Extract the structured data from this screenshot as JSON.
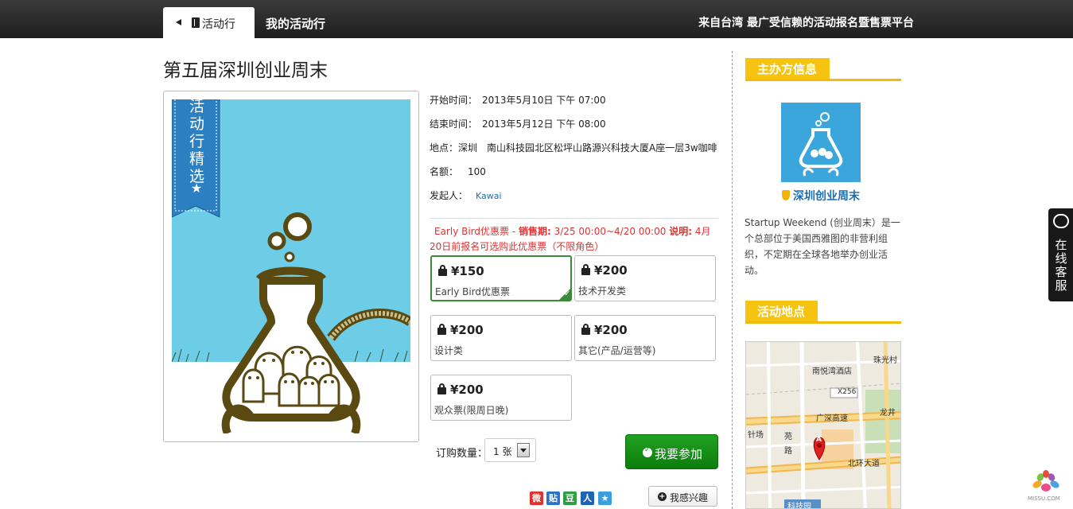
{
  "header": {
    "tabs": [
      {
        "label": "活动行",
        "active": true
      },
      {
        "label": "我的活动行",
        "active": false
      }
    ],
    "slogan": "来自台湾 最广受信赖的活动报名暨售票平台"
  },
  "event": {
    "title": "第五届深圳创业周末",
    "banner_text": "活动行精选",
    "start": {
      "label": "开始时间：",
      "value": "2013年5月10日 下午 07:00"
    },
    "end": {
      "label": "结束时间：",
      "value": "2013年5月12日 下午 08:00"
    },
    "location": {
      "label": "地点：",
      "value": "深圳　南山科技园北区松坪山路源兴科技大厦A座一层3w咖啡"
    },
    "quota": {
      "label": "名额：",
      "value": "100"
    },
    "organizer": {
      "label": "发起人：",
      "value": "Kawai"
    }
  },
  "ticket_note": {
    "name": "Early Bird优惠票 - ",
    "sale_label": "销售期:",
    "sale_period": " 3/25 00:00~4/20 00:00 ",
    "desc_label": "说明:",
    "desc": " 4月20日前报名可选购此优惠票（不限角色）"
  },
  "tickets": [
    {
      "price": "¥150",
      "name": "Early Bird优惠票",
      "selected": true
    },
    {
      "price": "¥200",
      "name": "技术开发类",
      "selected": false
    },
    {
      "price": "¥200",
      "name": "设计类",
      "selected": false
    },
    {
      "price": "¥200",
      "name": "其它(产品/运营等)",
      "selected": false
    },
    {
      "price": "¥200",
      "name": "观众票(限周日晚)",
      "selected": false
    }
  ],
  "order": {
    "qty_label": "订购数量：",
    "qty_value": "1 张",
    "join_label": "我要参加",
    "interest_label": "我感兴趣"
  },
  "share_icons": [
    {
      "icon": "weibo-icon",
      "glyph": "微",
      "color": "#e0322d"
    },
    {
      "icon": "tieba-icon",
      "glyph": "贴",
      "color": "#2a73c9"
    },
    {
      "icon": "douban-icon",
      "glyph": "豆",
      "color": "#2f9d43"
    },
    {
      "icon": "renren-icon",
      "glyph": "人",
      "color": "#1f63b8"
    },
    {
      "icon": "qzone-icon",
      "glyph": "★",
      "color": "#3a9fe0"
    }
  ],
  "sidebar": {
    "organizer_heading": "主办方信息",
    "org_name": "深圳创业周末",
    "org_desc": "Startup Weekend (创业周末）是一个总部位于美国西雅图的非营利组织，不定期在全球各地举办创业活动。",
    "location_heading": "活动地点",
    "map_labels": {
      "l1": "珠光村",
      "l2": "南悦湾酒店",
      "l3": "X256",
      "l4": "广深高速",
      "l5": "龙井",
      "l6": "针场",
      "l7": "苑",
      "l8": "路",
      "l9": "北环大道",
      "l10": "科技园",
      "marker": "A"
    }
  },
  "float": {
    "service_label": "在线客服"
  },
  "corner_logo_text": "MISSU.COM",
  "colors": {
    "accent_yellow": "#f6c311",
    "join_green": "#1a941a",
    "link_blue": "#1a6fb0",
    "note_red": "#d33333"
  }
}
